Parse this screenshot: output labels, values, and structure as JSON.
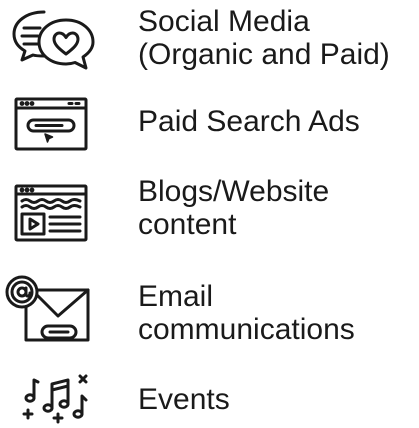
{
  "channels": [
    {
      "icon": "social-media-heart-chat-icon",
      "lines": [
        "Social Media",
        "(Organic and Paid)"
      ]
    },
    {
      "icon": "search-ad-browser-icon",
      "lines": [
        "Paid Search Ads"
      ]
    },
    {
      "icon": "website-video-content-icon",
      "lines": [
        "Blogs/Website",
        "content"
      ]
    },
    {
      "icon": "email-envelope-icon",
      "lines": [
        "Email",
        "communications"
      ]
    },
    {
      "icon": "music-notes-events-icon",
      "lines": [
        "Events"
      ]
    }
  ],
  "colors": {
    "text": "#1a1a1a",
    "icon_stroke": "#1a1a1a",
    "background": "#ffffff"
  }
}
